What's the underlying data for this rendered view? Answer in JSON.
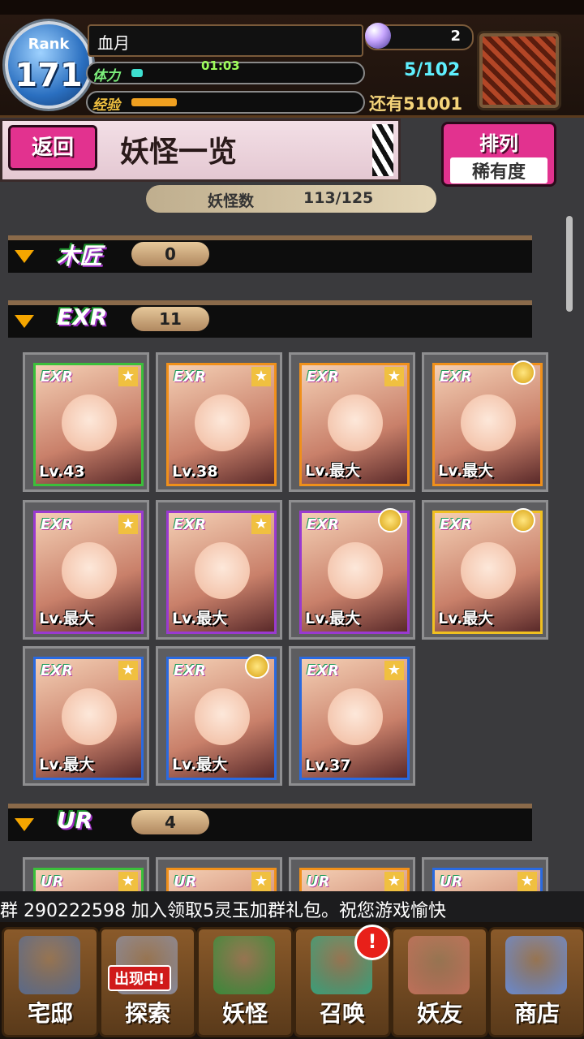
{
  "header": {
    "rank_label": "Rank",
    "rank_value": "171",
    "player_name": "血月",
    "stamina_label": "体力",
    "stamina_timer": "01:03",
    "stamina_fill": 0.05,
    "exp_label": "经验",
    "exp_fill": 0.2,
    "gems": "2",
    "stamina_value": "5/102",
    "remaining": "还有51001"
  },
  "title": {
    "back_label": "返回",
    "page_title": "妖怪一览",
    "sort_label": "排列",
    "sort_value": "稀有度"
  },
  "counter": {
    "label": "妖怪数",
    "value": "113/125"
  },
  "sections": [
    {
      "rarity": "木匠",
      "count": "0"
    },
    {
      "rarity": "EXR",
      "count": "11"
    },
    {
      "rarity": "UR",
      "count": "4"
    }
  ],
  "cards": [
    {
      "badge": "EXR",
      "level": "Lv.43",
      "medal": false,
      "frame": "#3bbf3b"
    },
    {
      "badge": "EXR",
      "level": "Lv.38",
      "medal": false,
      "frame": "#f0901a"
    },
    {
      "badge": "EXR",
      "level": "Lv.最大",
      "medal": false,
      "frame": "#f0901a"
    },
    {
      "badge": "EXR",
      "level": "Lv.最大",
      "medal": true,
      "frame": "#f0901a"
    },
    {
      "badge": "EXR",
      "level": "Lv.最大",
      "medal": false,
      "frame": "#9a3ad0"
    },
    {
      "badge": "EXR",
      "level": "Lv.最大",
      "medal": false,
      "frame": "#9a3ad0"
    },
    {
      "badge": "EXR",
      "level": "Lv.最大",
      "medal": true,
      "frame": "#9a3ad0"
    },
    {
      "badge": "EXR",
      "level": "Lv.最大",
      "medal": true,
      "frame": "#f0c020"
    },
    {
      "badge": "EXR",
      "level": "Lv.最大",
      "medal": false,
      "frame": "#2a6ae0"
    },
    {
      "badge": "EXR",
      "level": "Lv.最大",
      "medal": true,
      "frame": "#2a6ae0"
    },
    {
      "badge": "EXR",
      "level": "Lv.37",
      "medal": false,
      "frame": "#2a6ae0"
    }
  ],
  "ur_cards": [
    {
      "badge": "UR",
      "frame": "#3bbf3b"
    },
    {
      "badge": "UR",
      "frame": "#f0901a"
    },
    {
      "badge": "UR",
      "frame": "#f0901a"
    },
    {
      "badge": "UR",
      "frame": "#2a6ae0"
    }
  ],
  "ticker": "群 290222598   加入领取5灵玉加群礼包。祝您游戏愉快",
  "nav": [
    {
      "label": "宅邸",
      "icon": "mansion-icon",
      "color": "#5a6a8a"
    },
    {
      "label": "探索",
      "icon": "magnifier-icon",
      "color": "#8a8a9a",
      "tag": "出现中!"
    },
    {
      "label": "妖怪",
      "icon": "scroll-icon",
      "color": "#3a8a3a"
    },
    {
      "label": "召唤",
      "icon": "pentagram-icon",
      "color": "#3aa07a",
      "alert": "!"
    },
    {
      "label": "妖友",
      "icon": "foxgirl-icon",
      "color": "#c0705a"
    },
    {
      "label": "商店",
      "icon": "crystal-orb-icon",
      "color": "#6a8ad0"
    }
  ]
}
